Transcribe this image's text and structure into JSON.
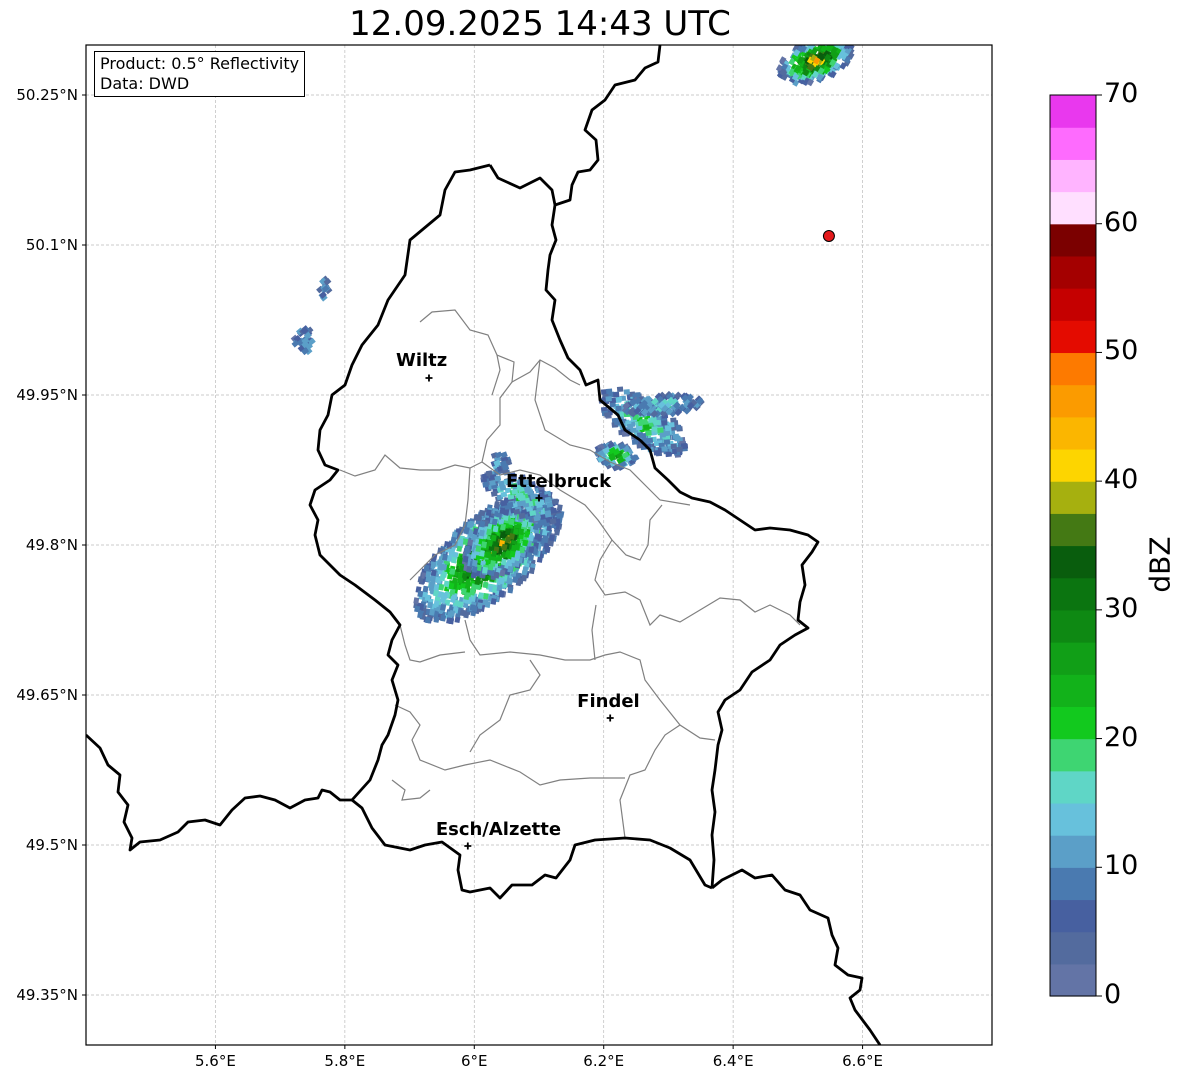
{
  "title": "12.09.2025 14:43 UTC",
  "info": {
    "product": "Product: 0.5° Reflectivity",
    "data_source": "Data: DWD"
  },
  "map_extent": {
    "lon": [
      5.4,
      6.8
    ],
    "lat": [
      49.3,
      50.3
    ]
  },
  "lat_ticks": [
    {
      "value": 50.25,
      "label": "50.25°N"
    },
    {
      "value": 50.1,
      "label": "50.1°N"
    },
    {
      "value": 49.95,
      "label": "49.95°N"
    },
    {
      "value": 49.8,
      "label": "49.8°N"
    },
    {
      "value": 49.65,
      "label": "49.65°N"
    },
    {
      "value": 49.5,
      "label": "49.5°N"
    },
    {
      "value": 49.35,
      "label": "49.35°N"
    }
  ],
  "lon_ticks": [
    {
      "value": 5.6,
      "label": "5.6°E"
    },
    {
      "value": 5.8,
      "label": "5.8°E"
    },
    {
      "value": 6.0,
      "label": "6°E"
    },
    {
      "value": 6.2,
      "label": "6.2°E"
    },
    {
      "value": 6.4,
      "label": "6.4°E"
    },
    {
      "value": 6.6,
      "label": "6.6°E"
    }
  ],
  "cities": [
    {
      "name": "Wiltz",
      "lon": 5.93,
      "lat": 49.967
    },
    {
      "name": "Ettelbruck",
      "lon": 6.1,
      "lat": 49.847
    },
    {
      "name": "Findel",
      "lon": 6.21,
      "lat": 49.627
    },
    {
      "name": "Esch/Alzette",
      "lon": 5.99,
      "lat": 49.499
    }
  ],
  "radar_site": {
    "lon": 6.548,
    "lat": 50.109,
    "color": "#e41a1c"
  },
  "colorbar": {
    "label": "dBZ",
    "min": 0,
    "max": 70,
    "step": 2.5,
    "tick_labels": [
      "0",
      "10",
      "20",
      "30",
      "40",
      "50",
      "60",
      "70"
    ],
    "colors": [
      "#6374a6",
      "#536b9e",
      "#4760a0",
      "#4a7ab0",
      "#5b9fc8",
      "#67c1dc",
      "#5fd6c6",
      "#3ed572",
      "#12c91e",
      "#12b21a",
      "#119f17",
      "#0e8913",
      "#0b7510",
      "#095d0d",
      "#447914",
      "#a6b00f",
      "#fdd500",
      "#fbb600",
      "#fb9b00",
      "#fd7a00",
      "#e40b00",
      "#c50000",
      "#a40000",
      "#7b0000",
      "#ffdfff",
      "#ffb4ff",
      "#fe6bfe",
      "#e938ee"
    ]
  }
}
